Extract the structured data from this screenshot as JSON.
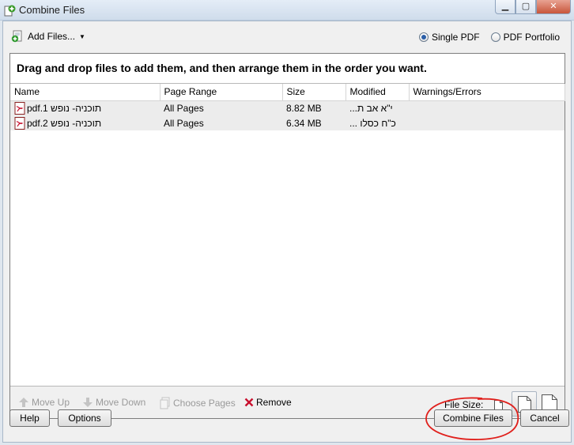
{
  "window": {
    "title": "Combine Files",
    "controls": [
      "minimize",
      "maximize",
      "close"
    ]
  },
  "toolbar_top": {
    "add_files_label": "Add Files...",
    "output_options": [
      {
        "label": "Single PDF",
        "selected": true
      },
      {
        "label": "PDF Portfolio",
        "selected": false
      }
    ]
  },
  "instruction": "Drag and drop files to add them, and then arrange them in the order you want.",
  "table": {
    "columns": [
      "Name",
      "Page Range",
      "Size",
      "Modified",
      "Warnings/Errors"
    ],
    "rows": [
      {
        "name": "תוכניה- נופש 1.pdf",
        "page_range": "All Pages",
        "size": "8.82 MB",
        "modified": "י\"א אב ת...",
        "warnings": ""
      },
      {
        "name": "תוכניה- נופש 2.pdf",
        "page_range": "All Pages",
        "size": "6.34 MB",
        "modified": "כ\"ח כסלו ...",
        "warnings": ""
      }
    ]
  },
  "list_actions": {
    "move_up": "Move Up",
    "move_down": "Move Down",
    "choose_pages": "Choose Pages",
    "remove": "Remove",
    "file_size_label": "File Size:"
  },
  "buttons": {
    "help": "Help",
    "options": "Options",
    "combine": "Combine Files",
    "cancel": "Cancel"
  },
  "colors": {
    "accent": "#2a5ea8",
    "annotation": "#e0201c",
    "remove_icon": "#c8102e"
  }
}
